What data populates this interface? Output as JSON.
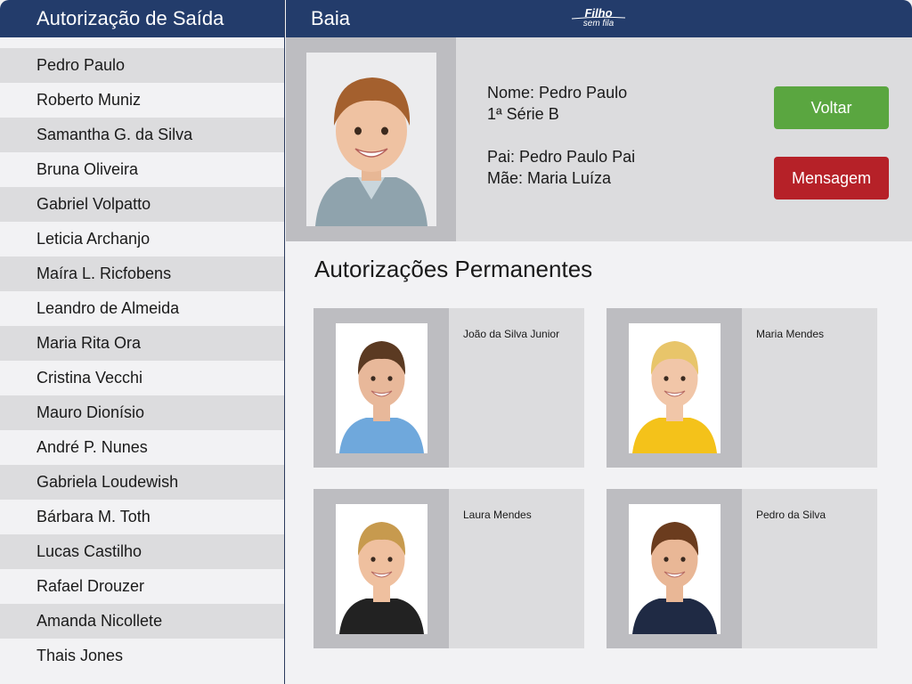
{
  "sidebar": {
    "title": "Autorização de Saída",
    "students": [
      "Pedro Paulo",
      "Roberto Muniz",
      "Samantha G. da Silva",
      "Bruna Oliveira",
      "Gabriel Volpatto",
      "Leticia Archanjo",
      "Maíra L. Ricfobens",
      "Leandro de Almeida",
      "Maria Rita Ora",
      "Cristina Vecchi",
      "Mauro Dionísio",
      "André P. Nunes",
      "Gabriela Loudewish",
      "Bárbara M. Toth",
      "Lucas Castilho",
      "Rafael Drouzer",
      "Amanda Nicollete",
      "Thais Jones"
    ]
  },
  "header": {
    "title": "Baia",
    "logo_line1": "Filho",
    "logo_line2": "sem fila"
  },
  "student": {
    "name": "Nome: Pedro Paulo",
    "grade": "1ª Série B",
    "father": "Pai: Pedro Paulo Pai",
    "mother": "Mãe: Maria Luíza",
    "back_label": "Voltar",
    "message_label": "Mensagem"
  },
  "authorizations": {
    "title": "Autorizações Permanentes",
    "people": [
      {
        "name": "João da Silva Junior",
        "shirt": "#6fa8dc",
        "hair": "#5b3a22",
        "skin": "#e8b89a"
      },
      {
        "name": "Maria Mendes",
        "shirt": "#f4c21a",
        "hair": "#e8c56a",
        "skin": "#f1c6a8"
      },
      {
        "name": "Laura Mendes",
        "shirt": "#222222",
        "hair": "#c79a4e",
        "skin": "#efc09f"
      },
      {
        "name": "Pedro da Silva",
        "shirt": "#1f2a44",
        "hair": "#6b3c1e",
        "skin": "#e9b796"
      }
    ]
  },
  "colors": {
    "header_bg": "#233c6b",
    "back_button": "#5aa640",
    "message_button": "#b62128"
  }
}
